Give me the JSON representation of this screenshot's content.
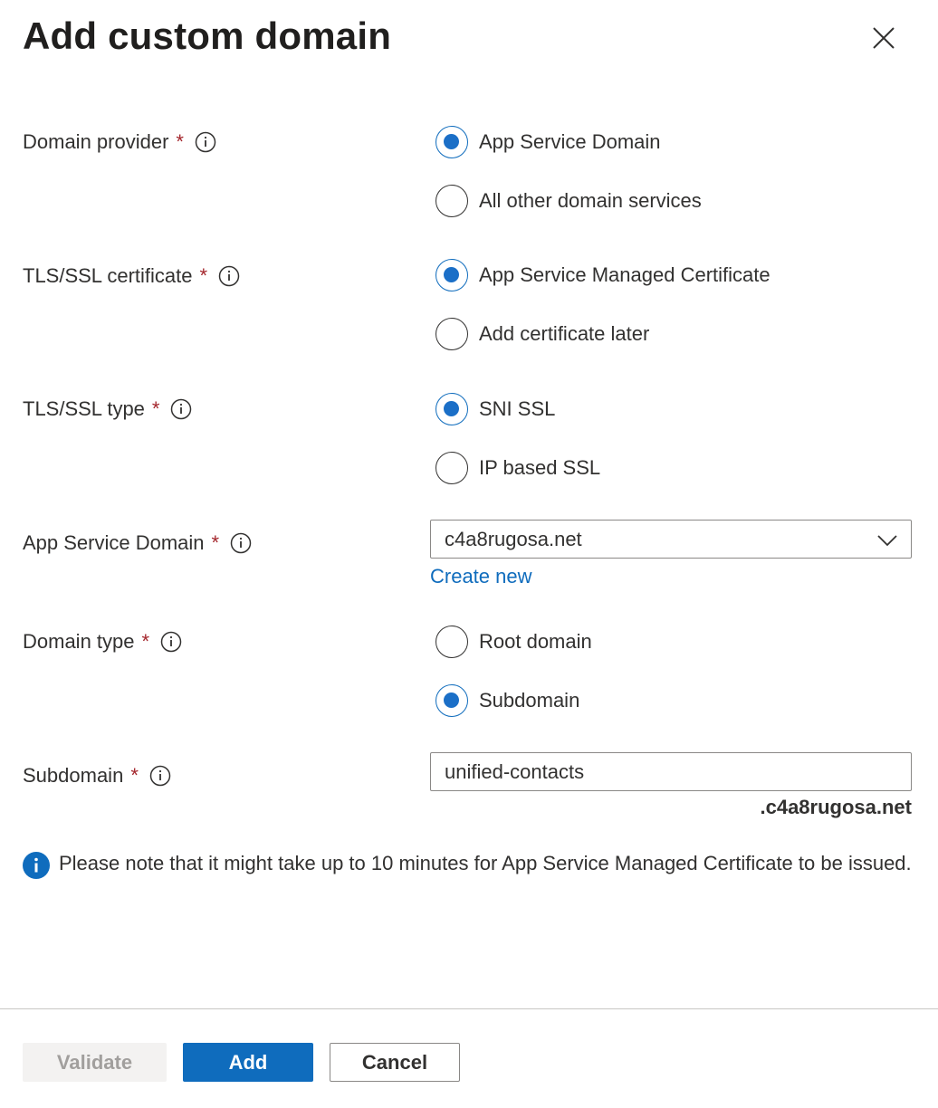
{
  "header": {
    "title": "Add custom domain"
  },
  "fields": {
    "domain_provider": {
      "label": "Domain provider",
      "required": "*",
      "options": [
        "App Service Domain",
        "All other domain services"
      ],
      "selected": "App Service Domain"
    },
    "tls_certificate": {
      "label": "TLS/SSL certificate",
      "required": "*",
      "options": [
        "App Service Managed Certificate",
        "Add certificate later"
      ],
      "selected": "App Service Managed Certificate"
    },
    "tls_type": {
      "label": "TLS/SSL type",
      "required": "*",
      "options": [
        "SNI SSL",
        "IP based SSL"
      ],
      "selected": "SNI SSL"
    },
    "app_service_domain": {
      "label": "App Service Domain",
      "required": "*",
      "value": "c4a8rugosa.net",
      "create_new": "Create new"
    },
    "domain_type": {
      "label": "Domain type",
      "required": "*",
      "options": [
        "Root domain",
        "Subdomain"
      ],
      "selected": "Subdomain"
    },
    "subdomain": {
      "label": "Subdomain",
      "required": "*",
      "value": "unified-contacts",
      "suffix": ".c4a8rugosa.net"
    }
  },
  "note": {
    "icon": "info-icon",
    "text": "Please note that it might take up to 10 minutes for App Service Managed Certificate to be issued."
  },
  "footer": {
    "validate_label": "Validate",
    "add_label": "Add",
    "cancel_label": "Cancel"
  },
  "colors": {
    "accent": "#0f6cbd",
    "required": "#a4262c",
    "disabled_bg": "#f3f2f1",
    "disabled_text": "#a19f9d"
  }
}
